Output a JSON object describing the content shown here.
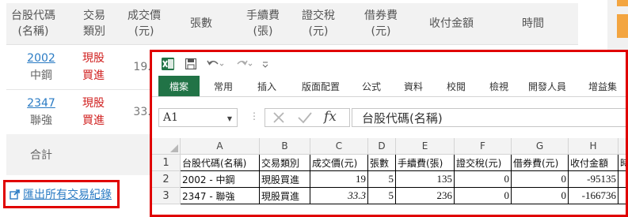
{
  "web_table": {
    "headers": [
      {
        "line1": "台股代碼",
        "line2": "(名稱)"
      },
      {
        "line1": "交易",
        "line2": "類別"
      },
      {
        "line1": "成交價",
        "line2": "(元)"
      },
      {
        "line1": "張數",
        "line2": ""
      },
      {
        "line1": "手續費",
        "line2": "(張)"
      },
      {
        "line1": "證交稅",
        "line2": "(元)"
      },
      {
        "line1": "借券費",
        "line2": "(元)"
      },
      {
        "line1": "收付金額",
        "line2": ""
      },
      {
        "line1": "時間",
        "line2": ""
      }
    ],
    "rows": [
      {
        "code": "2002",
        "name": "中鋼",
        "type_line1": "現股",
        "type_line2": "買進",
        "price": "19.0"
      },
      {
        "code": "2347",
        "name": "聯強",
        "type_line1": "現股",
        "type_line2": "買進",
        "price": "33.3"
      }
    ],
    "total_label": "合計"
  },
  "export_link": {
    "label": "匯出所有交易紀錄",
    "icon": "external-share-icon"
  },
  "excel": {
    "ribbon_tabs": [
      "檔案",
      "常用",
      "插入",
      "版面配置",
      "公式",
      "資料",
      "校閱",
      "檢視",
      "開發人員",
      "增益集"
    ],
    "active_tab": "檔案",
    "name_box": "A1",
    "fx_label": "fx",
    "formula_value": "台股代碼(名稱)",
    "columns": [
      "A",
      "B",
      "C",
      "D",
      "E",
      "F",
      "G",
      "H"
    ],
    "rows": [
      {
        "num": "1",
        "cells": [
          "台股代碼(名稱)",
          "交易類別",
          "成交價(元)",
          "張數",
          "手續費(張)",
          "證交稅(元)",
          "借券費(元)",
          "收付金額",
          "時"
        ]
      },
      {
        "num": "2",
        "cells": [
          "2002 - 中鋼",
          "現股買進",
          "19",
          "5",
          "135",
          "0",
          "0",
          "-95135",
          ""
        ]
      },
      {
        "num": "3",
        "cells": [
          "2347 - 聯強",
          "現股買進",
          "33.3",
          "5",
          "236",
          "0",
          "0",
          "-166736",
          ""
        ]
      }
    ]
  },
  "colors": {
    "excel_green": "#217346",
    "highlight_red": "#e00000",
    "link_blue": "#2a7bc4",
    "trade_red": "#d0201f"
  }
}
